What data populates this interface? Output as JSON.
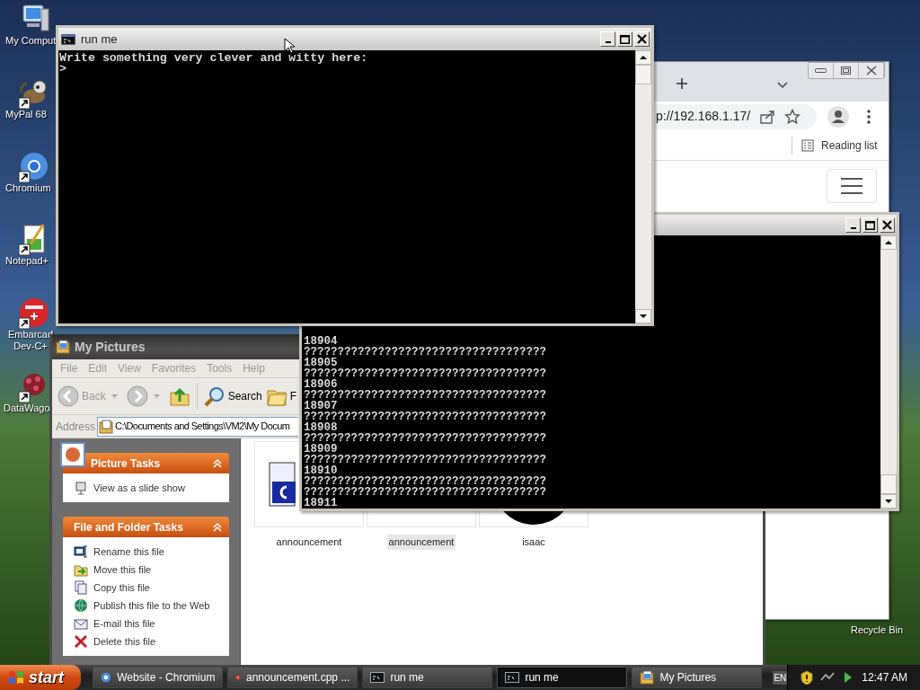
{
  "desktop_icons": [
    {
      "label": "My Comput",
      "kind": "computer",
      "shortcut": false
    },
    {
      "label": "MyPal 68",
      "kind": "raccoon",
      "shortcut": true
    },
    {
      "label": "Chromium",
      "kind": "chromium",
      "shortcut": true
    },
    {
      "label": "Notepad+",
      "kind": "notepad",
      "shortcut": true
    },
    {
      "label": "Embarcad Dev-C+",
      "kind": "devcpp",
      "shortcut": true
    },
    {
      "label": "DataWago",
      "kind": "datawagon",
      "shortcut": true
    },
    {
      "label": "Recycle Bin",
      "kind": "hidden",
      "shortcut": false
    }
  ],
  "browser_window": {
    "address": "p://192.168.1.17/",
    "bookmark": "Reading list"
  },
  "explorer_window": {
    "title": "My Pictures",
    "menu": [
      "File",
      "Edit",
      "View",
      "Favorites",
      "Tools",
      "Help"
    ],
    "toolbar": [
      {
        "label": "Back",
        "kind": "back"
      },
      {
        "label": "Search",
        "kind": "search"
      },
      {
        "label": "F",
        "kind": "folders"
      }
    ],
    "address_label": "Address",
    "address": "C:\\Documents and Settings\\VM2\\My Docum",
    "task_panels": [
      {
        "title": "Picture Tasks",
        "items": [
          {
            "label": "View as a slide show",
            "kind": "slideshow"
          }
        ]
      },
      {
        "title": "File and Folder Tasks",
        "items": [
          {
            "label": "Rename this file",
            "kind": "rename"
          },
          {
            "label": "Move this file",
            "kind": "move"
          },
          {
            "label": "Copy this file",
            "kind": "copy"
          },
          {
            "label": "Publish this file to the Web",
            "kind": "publish"
          },
          {
            "label": "E-mail this file",
            "kind": "email"
          },
          {
            "label": "Delete this file",
            "kind": "delete"
          }
        ]
      }
    ],
    "files": [
      {
        "name": "announcement",
        "kind": "document",
        "selected": false
      },
      {
        "name": "announcement",
        "kind": "blank",
        "selected": true
      },
      {
        "name": "isaac",
        "kind": "photo",
        "selected": false
      }
    ]
  },
  "console_back": {
    "lines": [
      "18904",
      "????????????????????????????????????",
      "18905",
      "????????????????????????????????????",
      "18906",
      "????????????????????????????????????",
      "18907",
      "????????????????????????????????????",
      "18908",
      "????????????????????????????????????",
      "18909",
      "????????????????????????????????????",
      "18910",
      "????????????????????????????????????",
      "????????????????????????????????????",
      "18911"
    ]
  },
  "console_front": {
    "title": "run me",
    "lines": [
      "Write something very clever and witty here:",
      ">"
    ]
  },
  "taskbar": {
    "start": "start",
    "items": [
      {
        "label": "Website - Chromium",
        "kind": "chromium",
        "selected": false
      },
      {
        "label": "announcement.cpp ...",
        "kind": "devcpp",
        "selected": false
      },
      {
        "label": "run me",
        "kind": "console",
        "selected": false
      },
      {
        "label": "run me",
        "kind": "console",
        "selected": true
      },
      {
        "label": "My Pictures",
        "kind": "folder",
        "selected": false
      }
    ],
    "language": "EN",
    "clock": "12:47 AM"
  }
}
